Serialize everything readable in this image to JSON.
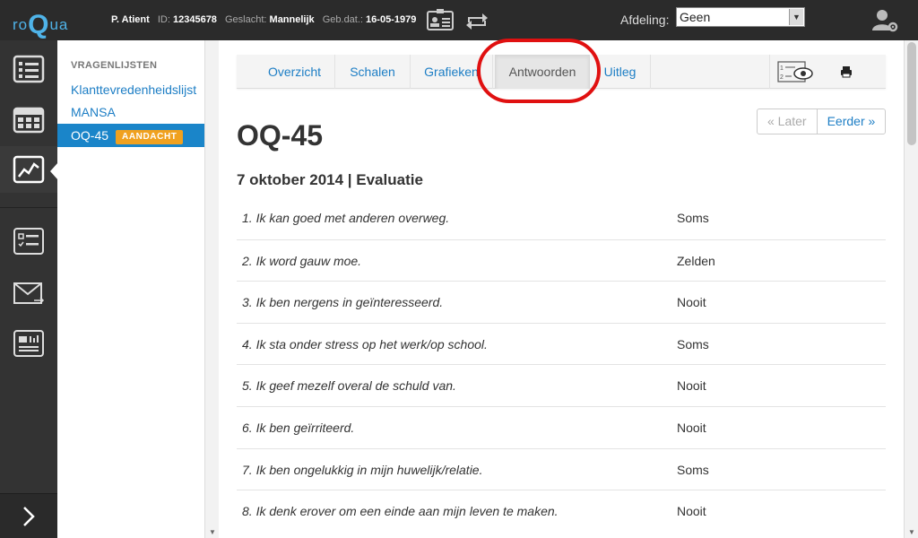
{
  "app": {
    "logo_prefix": "ro",
    "logo_q": "Q",
    "logo_suffix": "ua"
  },
  "patient": {
    "name": "P. Atient",
    "id_label": "ID:",
    "id_value": "12345678",
    "gender_label": "Geslacht:",
    "gender_value": "Mannelijk",
    "dob_label": "Geb.dat.:",
    "dob_value": "16-05-1979"
  },
  "afdeling": {
    "label": "Afdeling:",
    "value": "Geen"
  },
  "sidebar": {
    "title": "VRAGENLIJSTEN",
    "items": [
      {
        "label": "Klanttevredenheidslijst"
      },
      {
        "label": "MANSA"
      },
      {
        "label": "OQ-45",
        "badge": "AANDACHT"
      }
    ]
  },
  "tabs": [
    {
      "label": "Overzicht"
    },
    {
      "label": "Schalen"
    },
    {
      "label": "Grafieken"
    },
    {
      "label": "Antwoorden"
    },
    {
      "label": "Uitleg"
    }
  ],
  "pager": {
    "later": "« Later",
    "eerder": "Eerder »"
  },
  "questionnaire": {
    "title": "OQ-45",
    "subtitle": "7 oktober 2014 | Evaluatie",
    "answers": [
      {
        "q": "1. Ik kan goed met anderen overweg.",
        "a": "Soms"
      },
      {
        "q": "2. Ik word gauw moe.",
        "a": "Zelden"
      },
      {
        "q": "3. Ik ben nergens in geïnteresseerd.",
        "a": "Nooit"
      },
      {
        "q": "4. Ik sta onder stress op het werk/op school.",
        "a": "Soms"
      },
      {
        "q": "5. Ik geef mezelf overal de schuld van.",
        "a": "Nooit"
      },
      {
        "q": "6. Ik ben geïrriteerd.",
        "a": "Nooit"
      },
      {
        "q": "7. Ik ben ongelukkig in mijn huwelijk/relatie.",
        "a": "Soms"
      },
      {
        "q": "8. Ik denk erover om een einde aan mijn leven te maken.",
        "a": "Nooit"
      }
    ]
  },
  "colors": {
    "accent": "#1a85c9",
    "badge": "#f0a11f",
    "topbar": "#2b2b2b",
    "rail": "#333333",
    "highlight": "#e01010"
  }
}
